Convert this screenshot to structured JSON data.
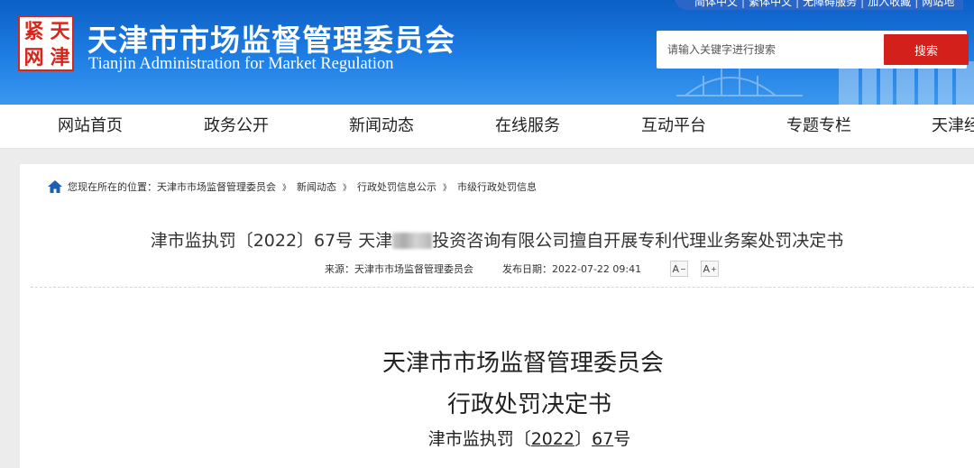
{
  "header": {
    "toplinks": [
      "简体中文",
      "繁体中文",
      "无障碍服务",
      "加入收藏",
      "网站地"
    ],
    "logo_seal_chars": [
      "紧",
      "天",
      "网",
      "津"
    ],
    "title": "天津市市场监督管理委员会",
    "subtitle": "Tianjin Administration for Market Regulation",
    "search": {
      "placeholder": "请输入关键字进行搜索",
      "button_label": "搜索"
    },
    "colors": {
      "header_blue": "#1473dc",
      "search_red": "#d4201b"
    }
  },
  "nav": {
    "items": [
      "网站首页",
      "政务公开",
      "新闻动态",
      "在线服务",
      "互动平台",
      "专题专栏",
      "天津经"
    ]
  },
  "breadcrumb": {
    "prefix": "您现在所在的位置：",
    "items": [
      "天津市市场监督管理委员会",
      "新闻动态",
      "行政处罚信息公示",
      "市级行政处罚信息"
    ],
    "separator": "》"
  },
  "article": {
    "title_before": "津市监执罚〔2022〕67号 天津",
    "title_after": "投资咨询有限公司擅自开展专利代理业务案处罚决定书",
    "source_label": "来源：",
    "source": "天津市市场监督管理委员会",
    "date_label": "发布日期：",
    "date": "2022-07-22 09:41",
    "font_decrease": "A",
    "font_increase": "A"
  },
  "document": {
    "org": "天津市市场监督管理委员会",
    "kind": "行政处罚决定书",
    "number_prefix": "津市监执罚〔",
    "number_year": "2022",
    "number_mid": "〕",
    "number_seq": "67",
    "number_suffix": "号"
  }
}
